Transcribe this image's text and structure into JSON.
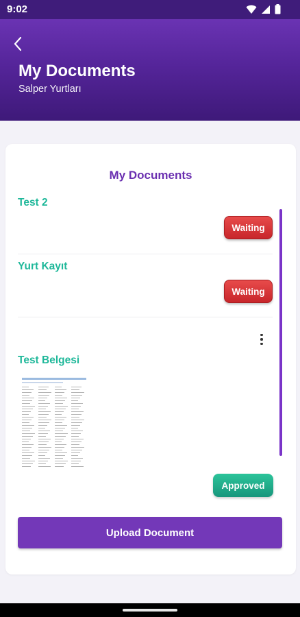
{
  "status_bar": {
    "time": "9:02",
    "icons": [
      "wifi-icon",
      "signal-icon",
      "battery-icon"
    ]
  },
  "header": {
    "title": "My Documents",
    "subtitle": "Salper Yurtları",
    "back_icon": "chevron-left-icon"
  },
  "card": {
    "title": "My Documents",
    "documents": [
      {
        "name": "Test 2",
        "status": "Waiting"
      },
      {
        "name": "Yurt Kayıt",
        "status": "Waiting"
      },
      {
        "name": "Test Belgesi",
        "status": "Approved",
        "has_preview": true,
        "has_menu": true
      }
    ],
    "upload_button": "Upload Document"
  },
  "colors": {
    "header_top": "#6a33b3",
    "header_bottom": "#3e1979",
    "accent_purple": "#7338b8",
    "doc_name_teal": "#1fb89a",
    "waiting_red": "#d8353a",
    "approved_green": "#1faa86"
  }
}
